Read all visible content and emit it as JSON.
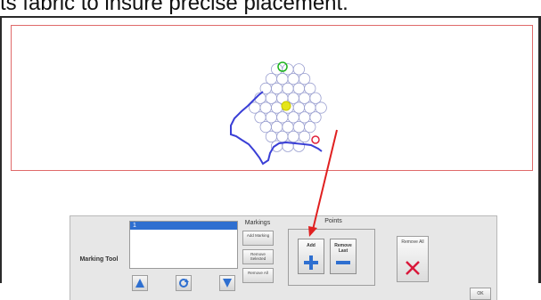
{
  "caption": "ts fabric to insure precise placement.",
  "marking_tool": {
    "label": "Marking Tool",
    "list_items": [
      "1"
    ],
    "markings": {
      "title": "Markings",
      "add_label": "Add Marking",
      "remove_selected_label": "Remove Selected",
      "remove_all_label": "Remove All"
    },
    "points": {
      "title": "Points",
      "add_label": "Add",
      "remove_last_label": "Remove Last"
    },
    "remove_all_points_label": "Remove All",
    "ok_label": "OK",
    "nav_icons": [
      "arrow-up-icon",
      "refresh-icon",
      "arrow-down-icon"
    ]
  },
  "colors": {
    "canvas_border": "#e06a6a",
    "outline": "#3a3fd6",
    "start_marker": "#1db41d",
    "center_marker": "#e5e51a",
    "end_marker": "#e0203a",
    "annotation_arrow": "#e02020",
    "selection": "#2e6fd0"
  }
}
